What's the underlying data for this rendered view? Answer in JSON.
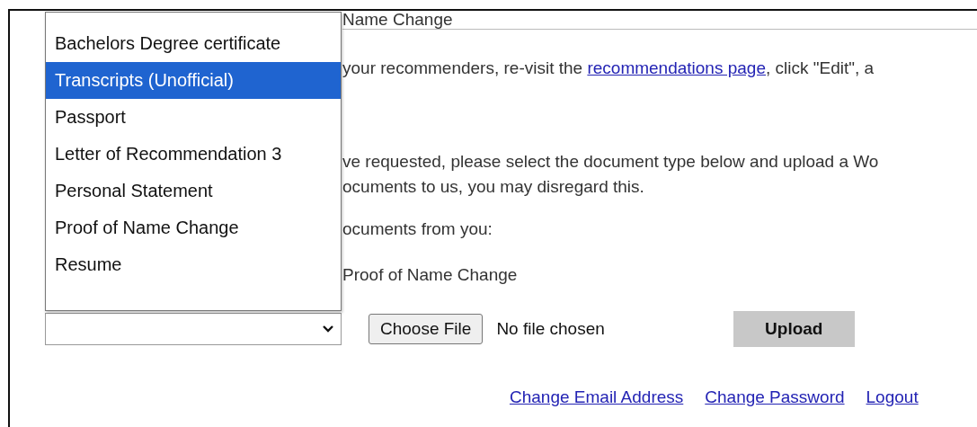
{
  "header": {
    "text": "Name Change"
  },
  "intro": {
    "before": "your recommenders, re-visit the ",
    "link": "recommendations page",
    "after": ", click \"Edit\", a"
  },
  "instructions": [
    "ve requested, please select the document type below and upload a Wo",
    "ocuments to us, you may disregard this."
  ],
  "requested_label": "ocuments from you:",
  "requested_items": [
    "Proof of Name Change"
  ],
  "document_type_dropdown": {
    "expanded": true,
    "options": [
      {
        "label": "Bachelors Degree certificate",
        "selected": false
      },
      {
        "label": "Transcripts (Unofficial)",
        "selected": true
      },
      {
        "label": "Passport",
        "selected": false
      },
      {
        "label": "Letter of Recommendation 3",
        "selected": false
      },
      {
        "label": "Personal Statement",
        "selected": false
      },
      {
        "label": "Proof of Name Change",
        "selected": false
      },
      {
        "label": "Resume",
        "selected": false
      }
    ]
  },
  "file_picker": {
    "button": "Choose File",
    "status": "No file chosen"
  },
  "upload_button": "Upload",
  "footer_links": [
    "Change Email Address",
    "Change Password",
    "Logout"
  ]
}
